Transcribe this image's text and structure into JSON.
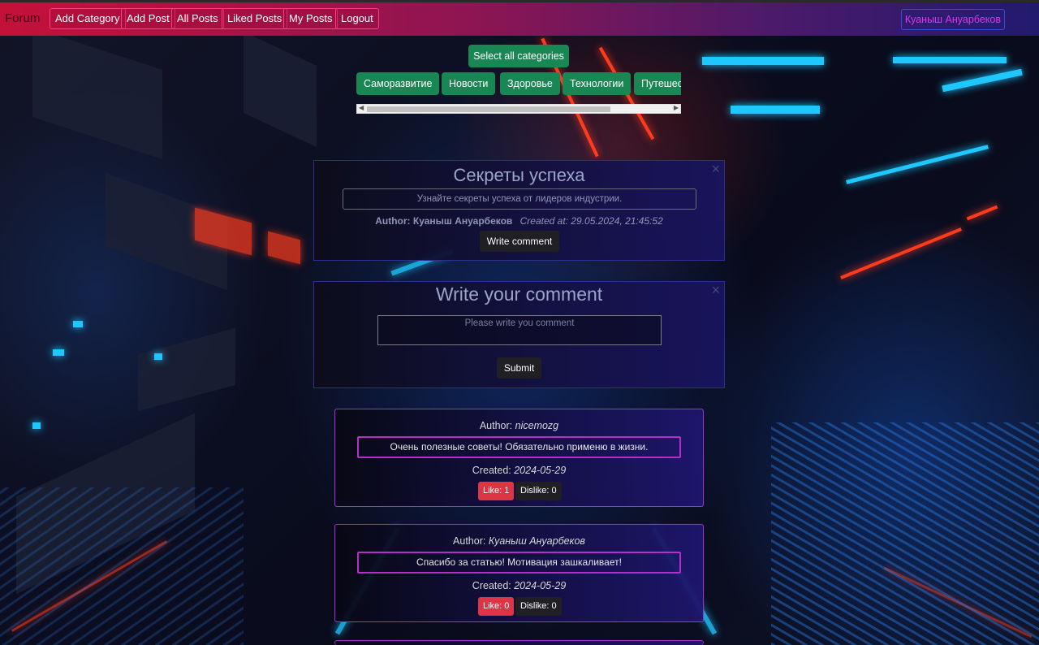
{
  "nav": {
    "brand": "Forum",
    "items": [
      "Add Category",
      "Add Post",
      "All Posts",
      "Liked Posts",
      "My Posts",
      "Logout"
    ],
    "user": "Куаныш Ануарбеков"
  },
  "categories": {
    "select_all": "Select all categories",
    "items": [
      "Саморазвитие",
      "Новости",
      "Здоровье",
      "Технологии",
      "Путешес"
    ]
  },
  "post": {
    "close": "×",
    "title": "Секреты успеха",
    "description": "Узнайте секреты успеха от лидеров индустрии.",
    "author_label": "Author: Куаныш Ануарбеков",
    "created_label": "Created at: 29.05.2024, 21:45:52",
    "write_comment": "Write comment"
  },
  "comment_form": {
    "close": "×",
    "title": "Write your comment",
    "placeholder": "Please write you comment",
    "submit": "Submit"
  },
  "comments": [
    {
      "author_prefix": "Author:",
      "author": "nicemozg",
      "text": "Очень полезные советы! Обязательно применю в жизни.",
      "created_prefix": "Created:",
      "created": "2024-05-29",
      "like": "Like: 1",
      "dislike": "Dislike: 0"
    },
    {
      "author_prefix": "Author:",
      "author": "Куаныш Ануарбеков",
      "text": "Спасибо за статью! Мотивация зашкаливает!",
      "created_prefix": "Created:",
      "created": "2024-05-29",
      "like": "Like: 0",
      "dislike": "Dislike: 0"
    }
  ],
  "colors": {
    "accent_green": "#198754",
    "like_red": "#dc3545",
    "comment_border": "#b52ec9"
  }
}
